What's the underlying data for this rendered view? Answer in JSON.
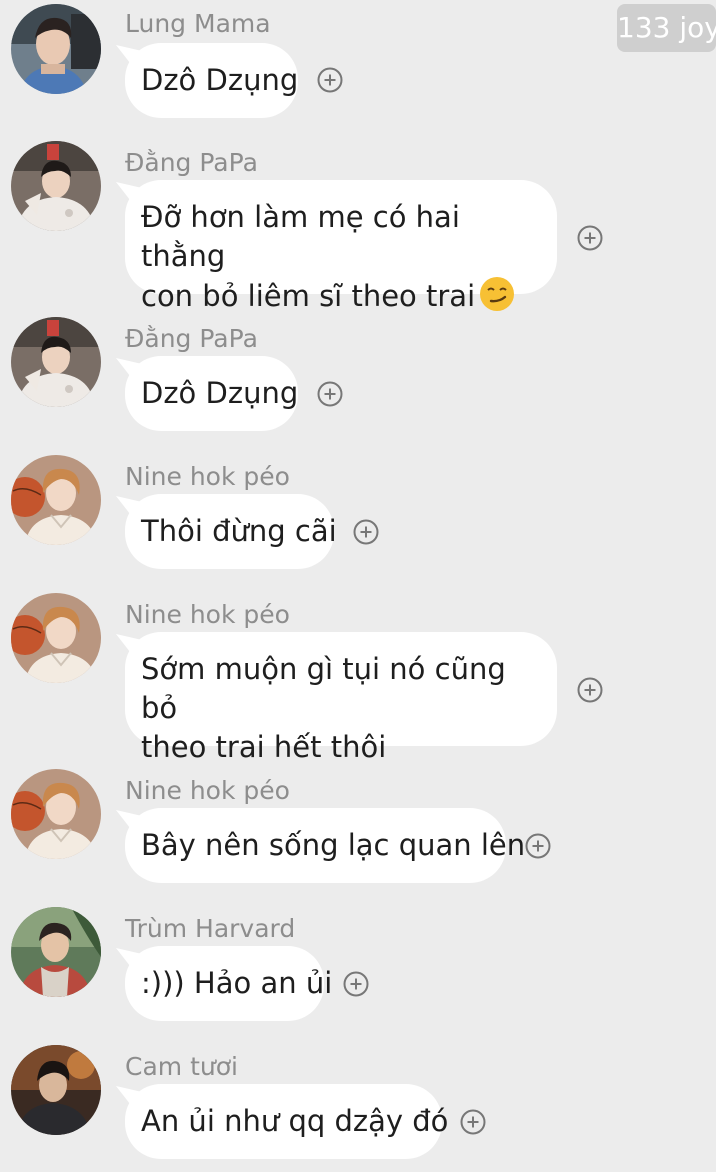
{
  "badge": {
    "count_label": "133 joy"
  },
  "messages": [
    {
      "sender": "Lung Mama",
      "avatar": "avatar-lung-mama",
      "lines": [
        "Dzô Dzụng"
      ]
    },
    {
      "sender": "Đằng PaPa",
      "avatar": "avatar-dang-papa",
      "lines": [
        "Đỡ hơn làm mẹ có hai thằng",
        "con bỏ liêm sĩ theo trai"
      ],
      "emoji": "smirking-face-emoji"
    },
    {
      "sender": "Đằng PaPa",
      "avatar": "avatar-dang-papa",
      "lines": [
        "Dzô Dzụng"
      ]
    },
    {
      "sender": "Nine hok péo",
      "avatar": "avatar-nine-hok-peo",
      "lines": [
        "Thôi đừng cãi"
      ]
    },
    {
      "sender": "Nine hok péo",
      "avatar": "avatar-nine-hok-peo",
      "lines": [
        "Sớm muộn gì tụi nó cũng bỏ",
        "theo trai hết thôi"
      ]
    },
    {
      "sender": "Nine hok péo",
      "avatar": "avatar-nine-hok-peo",
      "lines": [
        "Bây nên sống lạc quan lên"
      ]
    },
    {
      "sender": "Trùm Harvard",
      "avatar": "avatar-trum-harvard",
      "lines": [
        ":))) Hảo an ủi"
      ]
    },
    {
      "sender": "Cam tươi",
      "avatar": "avatar-cam-tuoi",
      "lines": [
        "An ủi như qq dzậy đó"
      ]
    }
  ],
  "icons": {
    "react_button": "add-reaction-icon"
  }
}
